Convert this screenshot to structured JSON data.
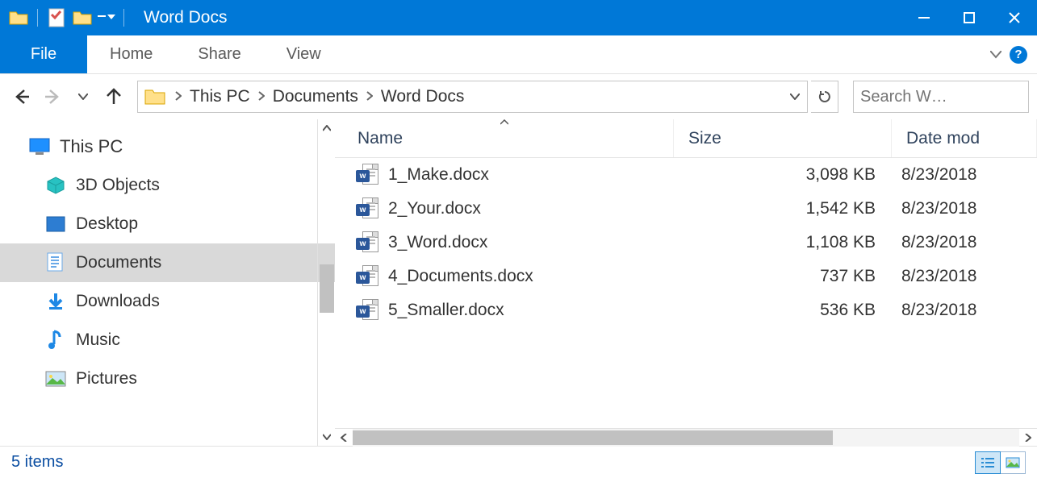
{
  "titlebar": {
    "title": "Word Docs"
  },
  "ribbon": {
    "file_label": "File",
    "tabs": [
      "Home",
      "Share",
      "View"
    ]
  },
  "breadcrumb": [
    "This PC",
    "Documents",
    "Word Docs"
  ],
  "search": {
    "placeholder": "Search W…"
  },
  "navpane": {
    "root": "This PC",
    "items": [
      {
        "label": "3D Objects"
      },
      {
        "label": "Desktop"
      },
      {
        "label": "Documents",
        "selected": true
      },
      {
        "label": "Downloads"
      },
      {
        "label": "Music"
      },
      {
        "label": "Pictures"
      }
    ]
  },
  "columns": {
    "name": "Name",
    "size": "Size",
    "date": "Date mod"
  },
  "files": [
    {
      "name": "1_Make.docx",
      "size": "3,098 KB",
      "date": "8/23/2018"
    },
    {
      "name": "2_Your.docx",
      "size": "1,542 KB",
      "date": "8/23/2018"
    },
    {
      "name": "3_Word.docx",
      "size": "1,108 KB",
      "date": "8/23/2018"
    },
    {
      "name": "4_Documents.docx",
      "size": "737 KB",
      "date": "8/23/2018"
    },
    {
      "name": "5_Smaller.docx",
      "size": "536 KB",
      "date": "8/23/2018"
    }
  ],
  "status": {
    "item_count": "5 items"
  }
}
